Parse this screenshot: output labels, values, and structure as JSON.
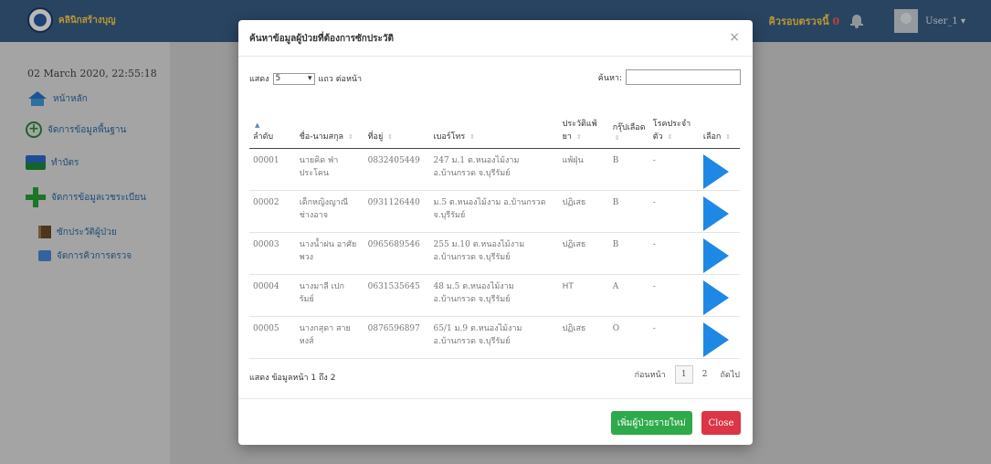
{
  "app": {
    "brand": "คลินิกสร้างบุญ",
    "queue_label": "คิวรอบตรวจนี้",
    "queue_count": "0",
    "user": "User_1 ▾"
  },
  "sidebar": {
    "datetime": "02 March 2020, 22:55:18",
    "items": [
      {
        "label": "หน้าหลัก",
        "icon": "home-icon"
      },
      {
        "label": "จัดการข้อมูลพื้นฐาน",
        "icon": "plus-circle-icon"
      },
      {
        "label": "ทำบัตร",
        "icon": "card-icon"
      },
      {
        "label": "จัดการข้อมูลเวชระเบียน",
        "icon": "plus-icon"
      },
      {
        "label": "ซักประวัติผู้ป่วย",
        "icon": "book-icon"
      },
      {
        "label": "จัดการคิวการตรวจ",
        "icon": "queue-icon"
      }
    ]
  },
  "modal": {
    "title": "ค้นหาข้อมูลผู้ป่วยที่ต้องการซักประวัติ",
    "close_symbol": "×",
    "length_prefix": "แสดง",
    "length_value": "5",
    "length_suffix": "แถว ต่อหน้า",
    "search_label": "ค้นหา:",
    "search_value": "",
    "columns": [
      {
        "label": "ลำดับ"
      },
      {
        "label": "ชื่อ-นามสกุล"
      },
      {
        "label": "ที่อยู่"
      },
      {
        "label": "เบอร์โทร"
      },
      {
        "label": "ประวัติแพ้ยา"
      },
      {
        "label": "กรุ๊ปเลือด"
      },
      {
        "label": "โรคประจำตัว"
      },
      {
        "label": "เลือก"
      }
    ],
    "rows": [
      {
        "id": "00001",
        "name": "นายคิด ฟ่า ประโคน",
        "phone": "0832405449",
        "address": "247 ม.1 ต.หนองไม้งาม อ.บ้านกรวด จ.บุรีรัมย์",
        "allergy": "แพ้ฝุ่น",
        "blood": "B",
        "disease": "-"
      },
      {
        "id": "00002",
        "name": "เด็กหญิงญาณี ช่างอาจ",
        "phone": "0931126440",
        "address": "ม.5 ต.หนองไม้งาม อ.บ้านกรวด จ.บุรีรัมย์",
        "allergy": "ปฏิเสธ",
        "blood": "B",
        "disease": "-"
      },
      {
        "id": "00003",
        "name": "นางน้ำฝน อาศัยพวง",
        "phone": "0965689546",
        "address": "255 ม.10 ต.หนองไม้งาม อ.บ้านกรวด จ.บุรีรัมย์",
        "allergy": "ปฏิเสธ",
        "blood": "B",
        "disease": "-"
      },
      {
        "id": "00004",
        "name": "นางมาลี เปก รัมย์",
        "phone": "0631535645",
        "address": "48 ม.5 ต.หนองไม้งาม อ.บ้านกรวด จ.บุรีรัมย์",
        "allergy": "HT",
        "blood": "A",
        "disease": "-"
      },
      {
        "id": "00005",
        "name": "นางกสุดา สาย หงส์",
        "phone": "0876596897",
        "address": "65/1 ม.9 ต.หนองไม้งาม อ.บ้านกรวด จ.บุรีรัมย์",
        "allergy": "ปฏิเสธ",
        "blood": "O",
        "disease": "-"
      }
    ],
    "info": "แสดง ข้อมูลหน้า 1 ถึง 2",
    "pager": {
      "prev": "ก่อนหน้า",
      "current": "1",
      "page2": "2",
      "next": "ถัดไป"
    },
    "add_button": "เพิ่มผู้ป่วยรายใหม่",
    "close_button": "Close",
    "colors": {
      "accent_green": "#2eaa4a",
      "danger": "#dc3545",
      "select_arrow": "#1e88e5"
    }
  }
}
